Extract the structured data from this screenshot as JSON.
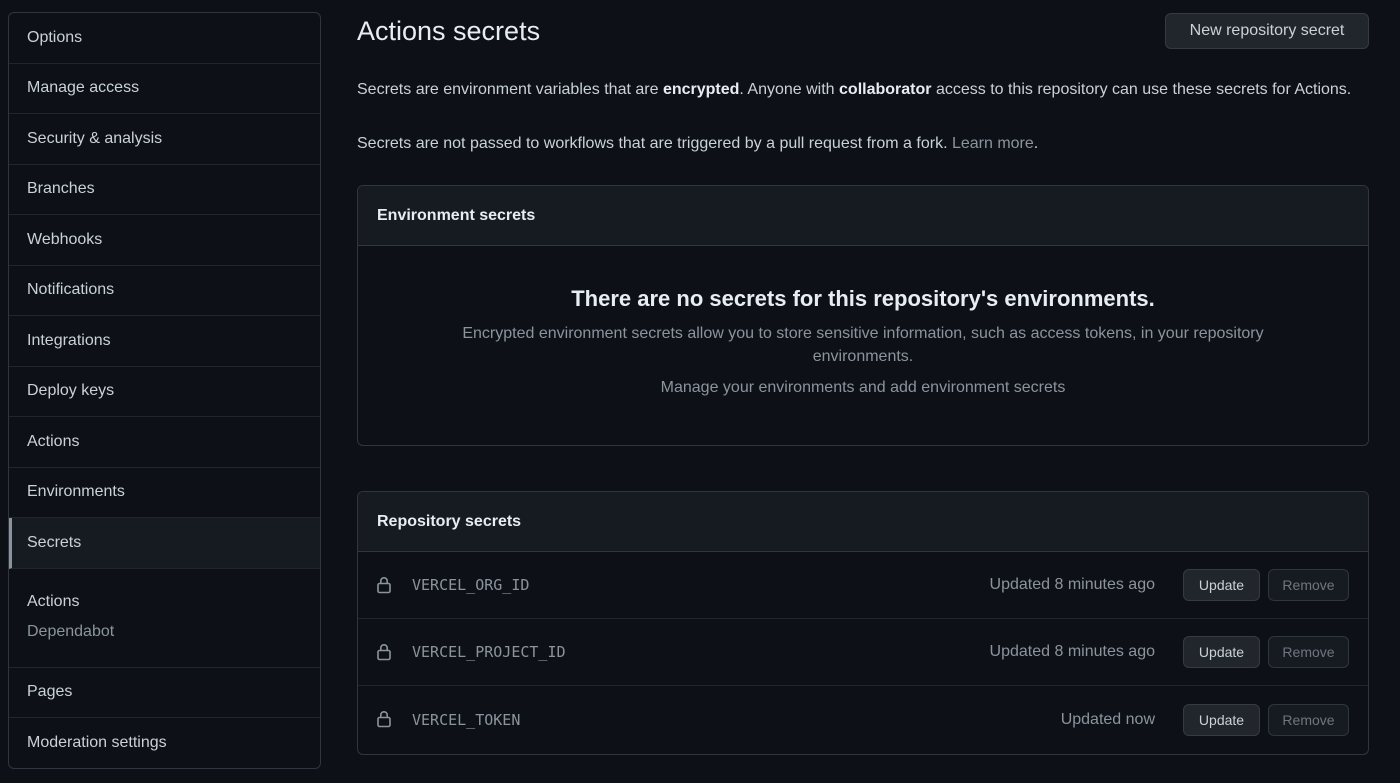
{
  "sidebar": {
    "items": [
      {
        "label": "Options"
      },
      {
        "label": "Manage access"
      },
      {
        "label": "Security & analysis"
      },
      {
        "label": "Branches"
      },
      {
        "label": "Webhooks"
      },
      {
        "label": "Notifications"
      },
      {
        "label": "Integrations"
      },
      {
        "label": "Deploy keys"
      },
      {
        "label": "Actions"
      },
      {
        "label": "Environments"
      },
      {
        "label": "Secrets",
        "selected": true
      }
    ],
    "group": {
      "title": "Actions",
      "sub": "Dependabot"
    },
    "after": [
      {
        "label": "Pages"
      },
      {
        "label": "Moderation settings"
      }
    ]
  },
  "header": {
    "title": "Actions secrets",
    "new_secret_label": "New repository secret"
  },
  "intro": {
    "p1_a": "Secrets are environment variables that are ",
    "p1_b": "encrypted",
    "p1_c": ". Anyone with ",
    "p1_d": "collaborator",
    "p1_e": " access to this repository can use these secrets for Actions.",
    "p2": "Secrets are not passed to workflows that are triggered by a pull request from a fork. ",
    "learn_more": "Learn more",
    "period": "."
  },
  "environment_secrets": {
    "header": "Environment secrets",
    "blank_title": "There are no secrets for this repository's environments.",
    "blank_desc": "Encrypted environment secrets allow you to store sensitive information, such as access tokens, in your repository environments.",
    "blank_link": "Manage your environments and add environment secrets"
  },
  "repository_secrets": {
    "header": "Repository secrets",
    "update_label": "Update",
    "remove_label": "Remove",
    "rows": [
      {
        "name": "VERCEL_ORG_ID",
        "updated": "Updated 8 minutes ago"
      },
      {
        "name": "VERCEL_PROJECT_ID",
        "updated": "Updated 8 minutes ago"
      },
      {
        "name": "VERCEL_TOKEN",
        "updated": "Updated now"
      }
    ]
  },
  "icons": {
    "lock": "lock-icon"
  },
  "colors": {
    "background": "#0d1117",
    "border": "#30363d",
    "header_bg": "#161b22"
  }
}
